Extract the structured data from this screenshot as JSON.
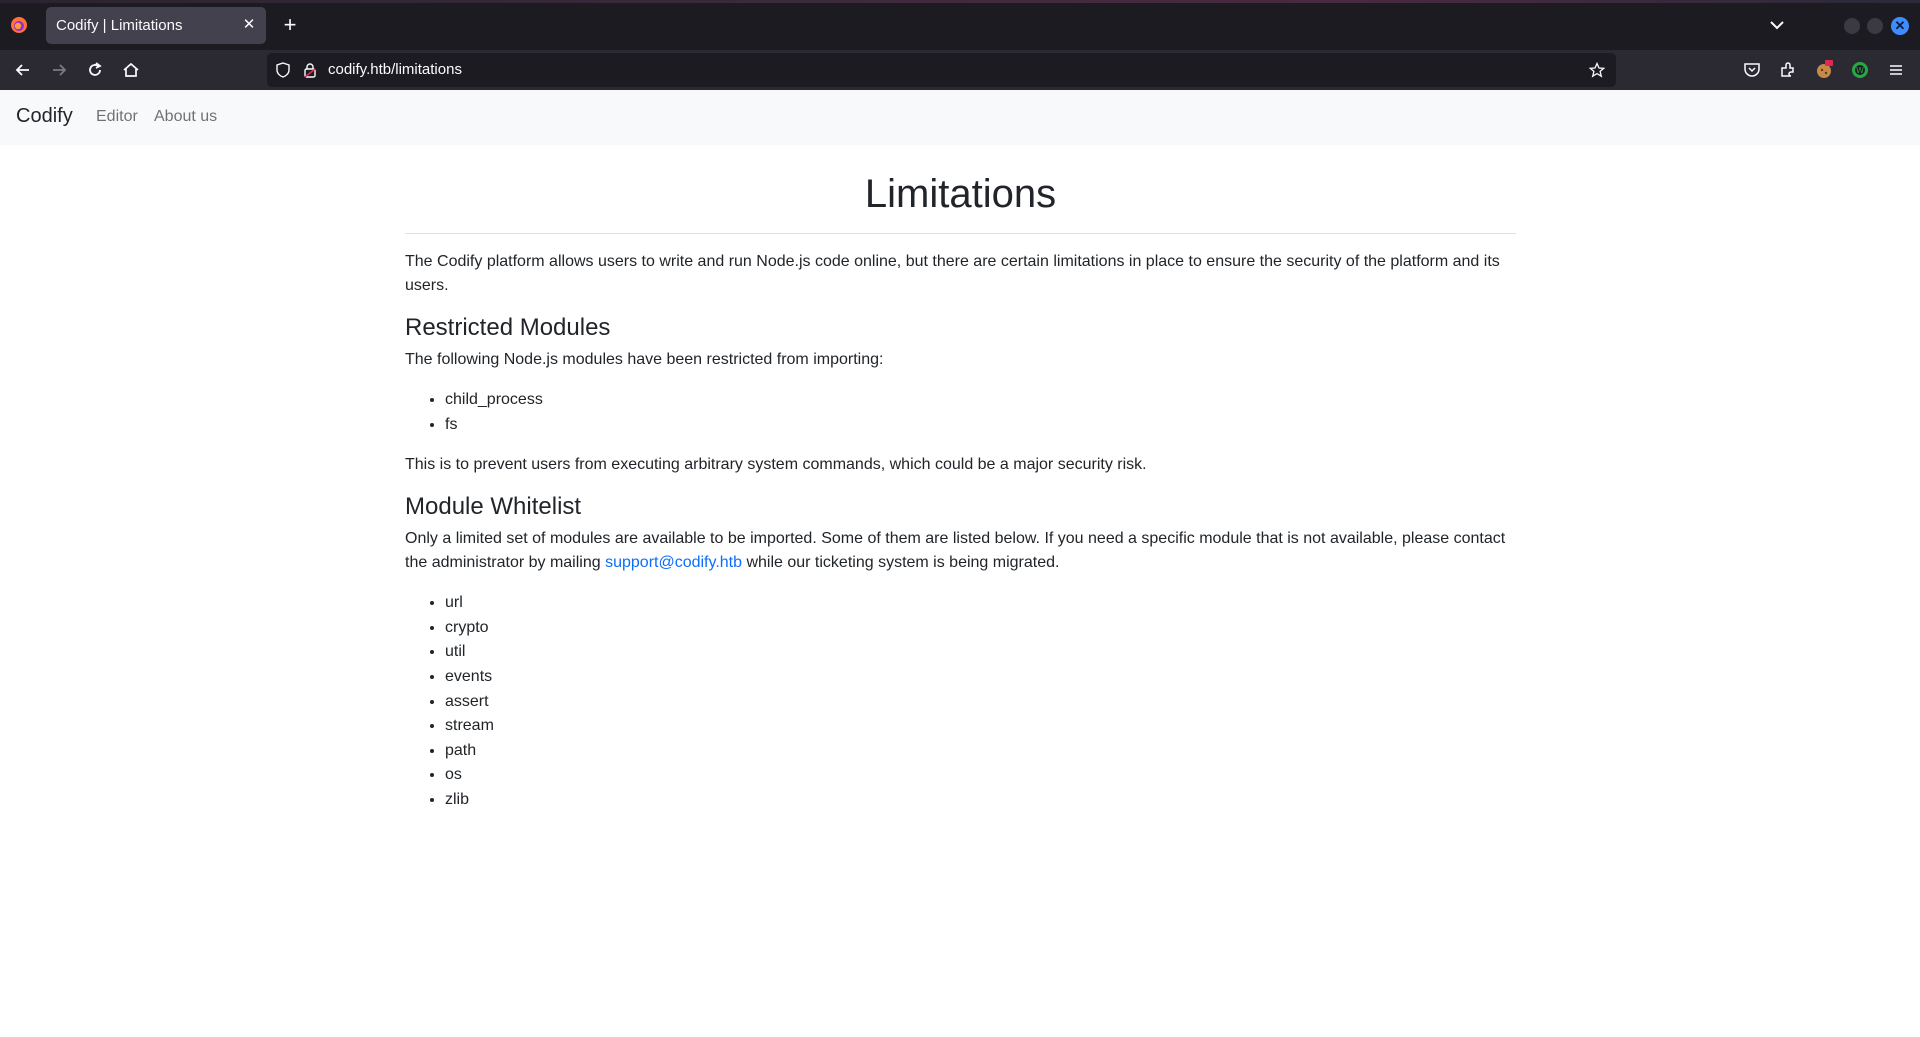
{
  "browser": {
    "tab_title": "Codify | Limitations",
    "url": "codify.htb/limitations",
    "icons": [
      "firefox-icon",
      "close-icon",
      "plus-icon",
      "chevron-down-icon",
      "back-icon",
      "forward-icon",
      "reload-icon",
      "home-icon",
      "shield-icon",
      "lock-icon",
      "star-icon",
      "pocket-icon",
      "extensions-icon",
      "extension-cookie-icon",
      "extension-wappalyzer-icon",
      "menu-icon"
    ]
  },
  "site_nav": {
    "brand": "Codify",
    "links": [
      "Editor",
      "About us"
    ]
  },
  "page": {
    "title": "Limitations",
    "intro": "The Codify platform allows users to write and run Node.js code online, but there are certain limitations in place to ensure the security of the platform and its users.",
    "restricted": {
      "heading": "Restricted Modules",
      "text": "The following Node.js modules have been restricted from importing:",
      "items": [
        "child_process",
        "fs"
      ],
      "note": "This is to prevent users from executing arbitrary system commands, which could be a major security risk."
    },
    "whitelist": {
      "heading": "Module Whitelist",
      "text_before": "Only a limited set of modules are available to be imported. Some of them are listed below. If you need a specific module that is not available, please contact the administrator by mailing ",
      "email": "support@codify.htb",
      "text_after": " while our ticketing system is being migrated.",
      "items": [
        "url",
        "crypto",
        "util",
        "events",
        "assert",
        "stream",
        "path",
        "os",
        "zlib"
      ]
    }
  },
  "colors": {
    "link": "#0d6efd",
    "chrome_dark": "#1c1b22",
    "toolbar": "#2b2a33",
    "navbar_bg": "#f8f9fa"
  }
}
